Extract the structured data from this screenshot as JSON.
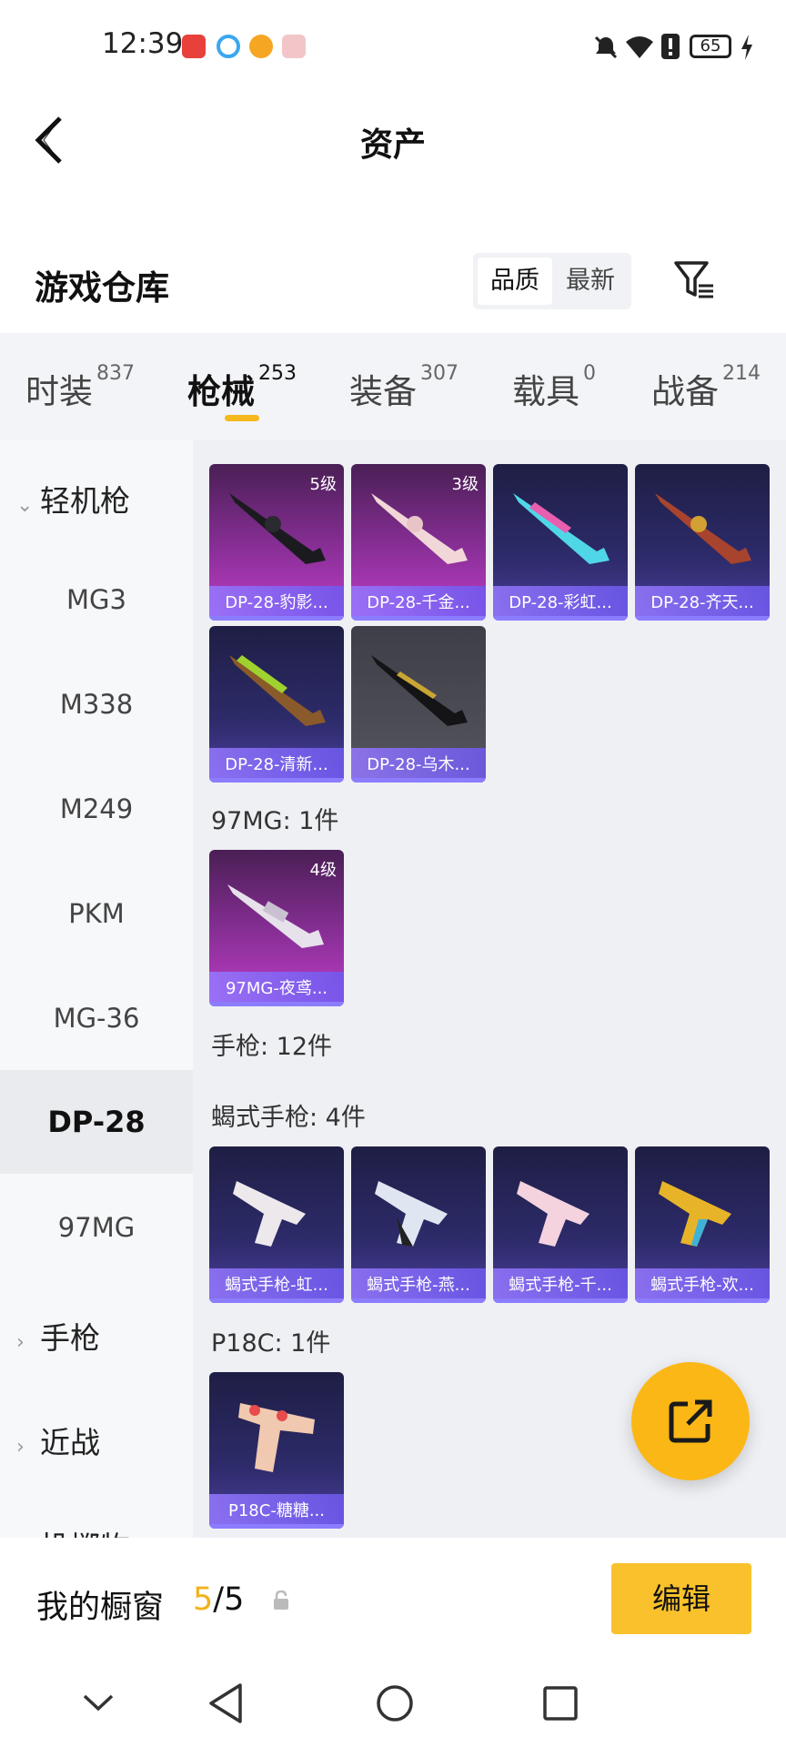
{
  "status": {
    "time": "12:39",
    "battery": "65"
  },
  "header": {
    "title": "资产"
  },
  "warehouse": {
    "title": "游戏仓库",
    "sort_quality": "品质",
    "sort_newest": "最新"
  },
  "tabs": [
    {
      "label": "时装",
      "count": "837"
    },
    {
      "label": "枪械",
      "count": "253"
    },
    {
      "label": "装备",
      "count": "307"
    },
    {
      "label": "载具",
      "count": "0"
    },
    {
      "label": "战备",
      "count": "214"
    }
  ],
  "sidebar": {
    "group_lmg": "轻机枪",
    "items": [
      "MG3",
      "M338",
      "M249",
      "PKM",
      "MG-36",
      "DP-28",
      "97MG"
    ],
    "group_pistol": "手枪",
    "group_melee": "近战",
    "group_throw": "投掷物"
  },
  "content": {
    "dp28_cards": [
      {
        "name": "DP-28-豹影...",
        "level": "5级"
      },
      {
        "name": "DP-28-千金...",
        "level": "3级"
      },
      {
        "name": "DP-28-彩虹..."
      },
      {
        "name": "DP-28-齐天..."
      },
      {
        "name": "DP-28-清新..."
      },
      {
        "name": "DP-28-乌木..."
      }
    ],
    "section_97mg": "97MG: 1件",
    "mg97_cards": [
      {
        "name": "97MG-夜鸢...",
        "level": "4级"
      }
    ],
    "section_pistol": "手枪: 12件",
    "section_scorpion": "蝎式手枪: 4件",
    "scorpion_cards": [
      {
        "name": "蝎式手枪-虹..."
      },
      {
        "name": "蝎式手枪-燕..."
      },
      {
        "name": "蝎式手枪-千..."
      },
      {
        "name": "蝎式手枪-欢..."
      }
    ],
    "section_p18c": "P18C: 1件",
    "p18c_cards": [
      {
        "name": "P18C-糖糖..."
      }
    ]
  },
  "showcase": {
    "label": "我的橱窗",
    "count": "5",
    "total": "/5",
    "edit": "编辑"
  }
}
